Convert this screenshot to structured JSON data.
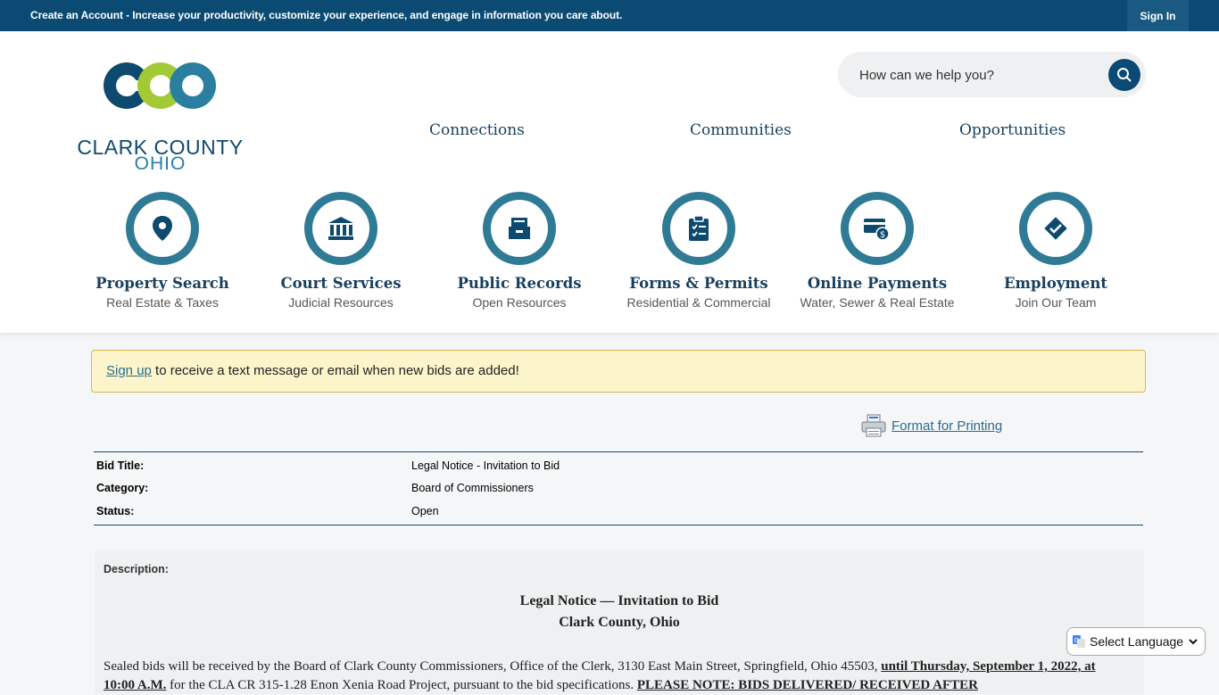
{
  "topbar": {
    "message_bold": "Create an Account",
    "message_rest": " - Increase your productivity, customize your experience, and engage in information you care about.",
    "signin": "Sign In"
  },
  "logo": {
    "line1": "CLARK COUNTY",
    "line2": "OHIO",
    "letters": "CCO",
    "colors": {
      "dark": "#0e4a6e",
      "green": "#a3c936",
      "teal": "#2a7fa0"
    }
  },
  "search": {
    "placeholder": "How can we help you?"
  },
  "nav": [
    "Connections",
    "Communities",
    "Opportunities"
  ],
  "tiles": [
    {
      "title": "Property Search",
      "subtitle": "Real Estate & Taxes",
      "icon": "map-pin-icon"
    },
    {
      "title": "Court Services",
      "subtitle": "Judicial Resources",
      "icon": "courthouse-icon"
    },
    {
      "title": "Public Records",
      "subtitle": "Open Resources",
      "icon": "file-box-icon"
    },
    {
      "title": "Forms & Permits",
      "subtitle": "Residential & Commercial",
      "icon": "clipboard-icon"
    },
    {
      "title": "Online Payments",
      "subtitle": "Water, Sewer & Real Estate",
      "icon": "payment-card-icon"
    },
    {
      "title": "Employment",
      "subtitle": "Join Our Team",
      "icon": "checkmark-badge-icon"
    }
  ],
  "notice": {
    "link": "Sign up",
    "text": " to receive a text message or email when new bids are added!"
  },
  "print": {
    "label": "Format for Printing"
  },
  "bid": {
    "rows": [
      {
        "key": "Bid Title:",
        "value": "Legal Notice - Invitation to Bid"
      },
      {
        "key": "Category:",
        "value": "Board of Commissioners"
      },
      {
        "key": "Status:",
        "value": "Open"
      }
    ]
  },
  "description": {
    "label": "Description:",
    "heading1": "Legal Notice — Invitation to Bid",
    "heading2": "Clark County, Ohio",
    "para_start": "Sealed bids will be received by the Board of Clark County Commissioners, Office of the Clerk, 3130 East Main Street, Springfield, Ohio 45503, ",
    "para_bold": "until Thursday, September 1, 2022, at 10:00 A.M.",
    "para_mid": " for the CLA CR 315-1.28 Enon Xenia Road Project, pursuant to the bid specifications. ",
    "para_bold2": "PLEASE NOTE: BIDS DELIVERED/ RECEIVED AFTER"
  },
  "translate": {
    "label": "Select Language"
  }
}
